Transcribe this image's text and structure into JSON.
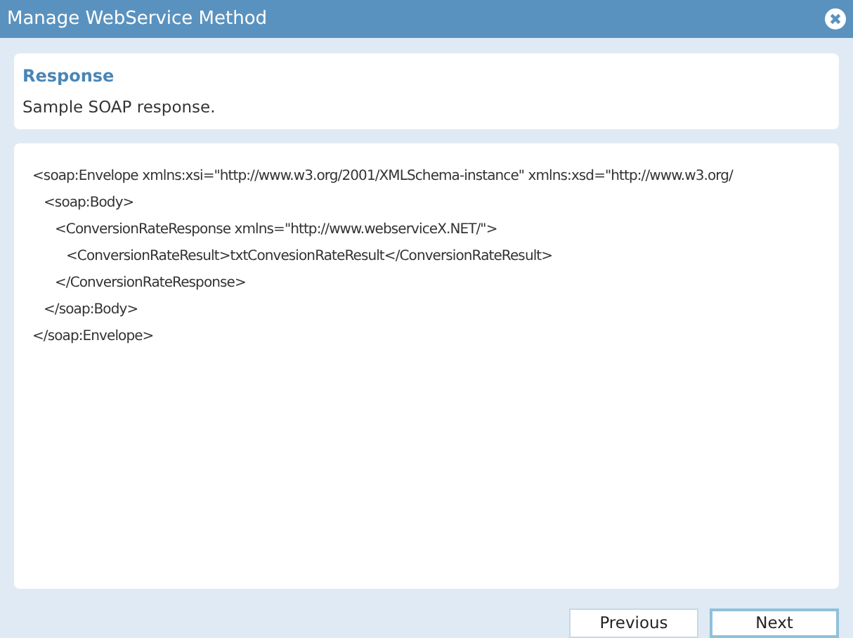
{
  "window": {
    "title": "Manage WebService Method"
  },
  "header": {
    "title": "Response",
    "description": "Sample SOAP response."
  },
  "code": [
    {
      "open": "<soap:Envelope xmlns:xsi=\"http://www.w3.org/2001/XMLSchema-instance\" xmlns:xsd=\"http://www.w3.org/",
      "close": "</soap:Envelope>",
      "children": [
        {
          "open": "<soap:Body>",
          "close": "</soap:Body>",
          "children": [
            {
              "open": "<ConversionRateResponse xmlns=\"http://www.webserviceX.NET/\">",
              "close": "</ConversionRateResponse>",
              "children": [
                {
                  "open": "<ConversionRateResult>txtConvesionRateResult</ConversionRateResult>"
                }
              ]
            }
          ]
        }
      ]
    }
  ],
  "buttons": [
    {
      "label": "Previous",
      "selected": false
    },
    {
      "label": "Next",
      "selected": true
    }
  ]
}
